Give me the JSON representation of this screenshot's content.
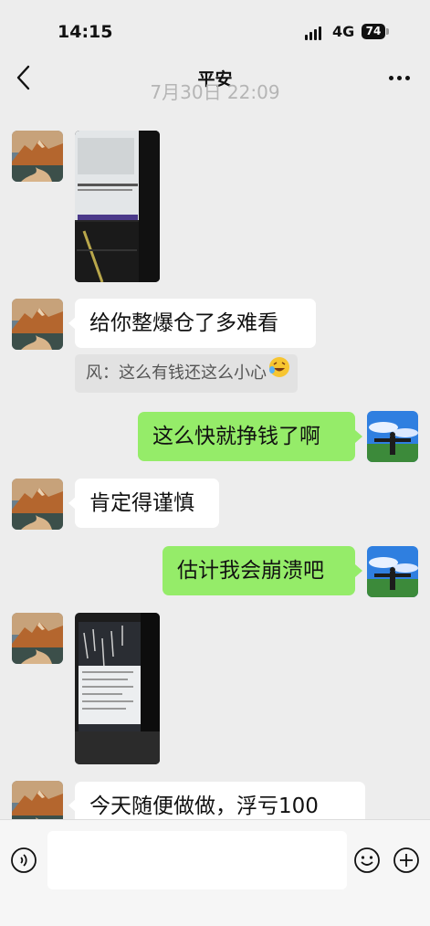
{
  "status_bar": {
    "time": "14:15",
    "network": "4G",
    "battery": "74"
  },
  "nav": {
    "title": "平安",
    "back_icon": "chevron-left-icon",
    "more_icon": "ellipsis-icon"
  },
  "timestamp": "7月30日 22:09",
  "messages": [
    {
      "side": "in",
      "type": "image",
      "desc_icon": "screenshot-thumbnail"
    },
    {
      "side": "in",
      "type": "text",
      "text": "给你整爆仓了多难看"
    },
    {
      "side": "in",
      "type": "quote",
      "text": "风：这么有钱还这么小心"
    },
    {
      "side": "out",
      "type": "text",
      "text": "这么快就挣钱了啊"
    },
    {
      "side": "in",
      "type": "text",
      "text": "肯定得谨慎"
    },
    {
      "side": "out",
      "type": "text",
      "text": "估计我会崩溃吧"
    },
    {
      "side": "in",
      "type": "image",
      "desc_icon": "screenshot-thumbnail"
    },
    {
      "side": "in",
      "type": "text",
      "text": "今天随便做做，浮亏100"
    }
  ],
  "input": {
    "placeholder": "",
    "voice_icon": "voice-icon",
    "emoji_icon": "emoji-icon",
    "plus_icon": "plus-icon"
  },
  "colors": {
    "background": "#ededed",
    "bubble_out": "#95ec69",
    "bubble_in": "#ffffff"
  }
}
